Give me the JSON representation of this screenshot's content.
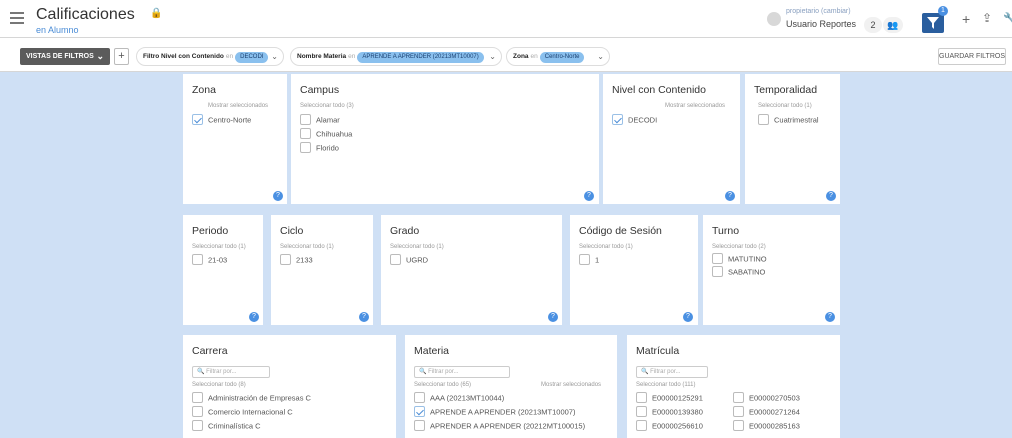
{
  "header": {
    "title": "Calificaciones",
    "subtitle": "en Alumno",
    "owner_label": "propietario (cambiar)",
    "user_name": "Usuario Reportes",
    "count": "2",
    "filter_badge": "1"
  },
  "filterbar": {
    "views_label": "VISTAS DE FILTROS",
    "save_label": "GUARDAR FILTROS",
    "in_word": "en",
    "chips": [
      {
        "name": "Filtro Nivel con Contenido",
        "value": "DECODI"
      },
      {
        "name": "Nombre Materia",
        "value": "APRENDE A APRENDER (20213MT10007)"
      },
      {
        "name": "Zona",
        "value": "Centro-Norte"
      }
    ]
  },
  "cards": {
    "zona": {
      "title": "Zona",
      "sub": "Mostrar seleccionados",
      "options": [
        "Centro-Norte"
      ]
    },
    "campus": {
      "title": "Campus",
      "sub": "Seleccionar todo (3)",
      "options": [
        "Alamar",
        "Chihuahua",
        "Florido"
      ]
    },
    "nivel": {
      "title": "Nivel con Contenido",
      "sub": "Mostrar seleccionados",
      "options": [
        "DECODI"
      ]
    },
    "temporalidad": {
      "title": "Temporalidad",
      "sub": "Seleccionar todo (1)",
      "options": [
        "Cuatrimestral"
      ]
    },
    "periodo": {
      "title": "Periodo",
      "sub": "Seleccionar todo (1)",
      "options": [
        "21-03"
      ]
    },
    "ciclo": {
      "title": "Ciclo",
      "sub": "Seleccionar todo (1)",
      "options": [
        "2133"
      ]
    },
    "grado": {
      "title": "Grado",
      "sub": "Seleccionar todo (1)",
      "options": [
        "UGRD"
      ]
    },
    "sesion": {
      "title": "Código de Sesión",
      "sub": "Seleccionar todo (1)",
      "options": [
        "1"
      ]
    },
    "turno": {
      "title": "Turno",
      "sub": "Seleccionar todo (2)",
      "options": [
        "MATUTINO",
        "SABATINO"
      ]
    },
    "carrera": {
      "title": "Carrera",
      "placeholder": "Filtrar por...",
      "sub": "Seleccionar todo (8)",
      "options": [
        "Administración de Empresas C",
        "Comercio Internacional C",
        "Criminalística C"
      ]
    },
    "materia": {
      "title": "Materia",
      "placeholder": "Filtrar por...",
      "sub": "Seleccionar todo (65)",
      "sub2": "Mostrar seleccionados",
      "options": [
        "AAA (20213MT10044)",
        "APRENDE A APRENDER (20213MT10007)",
        "APRENDER A APRENDER (20212MT100015)"
      ]
    },
    "matricula": {
      "title": "Matrícula",
      "placeholder": "Filtrar por...",
      "sub": "Seleccionar todo (111)",
      "col1": [
        "E00000125291",
        "E00000139380",
        "E00000256610"
      ],
      "col2": [
        "E00000270503",
        "E00000271264",
        "E00000285163"
      ]
    }
  }
}
